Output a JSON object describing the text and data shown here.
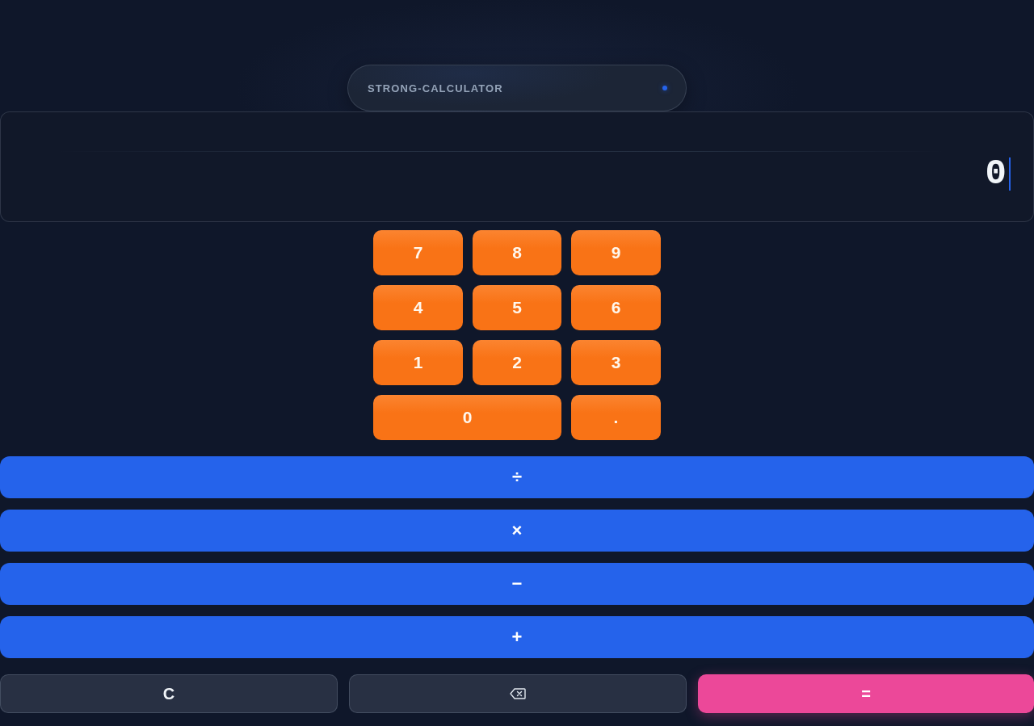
{
  "header": {
    "title": "STRONG-CALCULATOR"
  },
  "display": {
    "value": "0",
    "focused": true
  },
  "keypad": [
    {
      "label": "7",
      "kind": "digit"
    },
    {
      "label": "8",
      "kind": "digit"
    },
    {
      "label": "9",
      "kind": "digit"
    },
    {
      "label": "4",
      "kind": "digit"
    },
    {
      "label": "5",
      "kind": "digit"
    },
    {
      "label": "6",
      "kind": "digit"
    },
    {
      "label": "1",
      "kind": "digit"
    },
    {
      "label": "2",
      "kind": "digit"
    },
    {
      "label": "3",
      "kind": "digit"
    },
    {
      "label": "0",
      "kind": "wide"
    },
    {
      "label": ".",
      "kind": "digit"
    }
  ],
  "operators": [
    {
      "label": "÷"
    },
    {
      "label": "×"
    },
    {
      "label": "−"
    },
    {
      "label": "+"
    }
  ],
  "actions": [
    {
      "kind": "clear",
      "label": "C"
    },
    {
      "kind": "backspace"
    },
    {
      "kind": "equals",
      "label": "="
    }
  ]
}
